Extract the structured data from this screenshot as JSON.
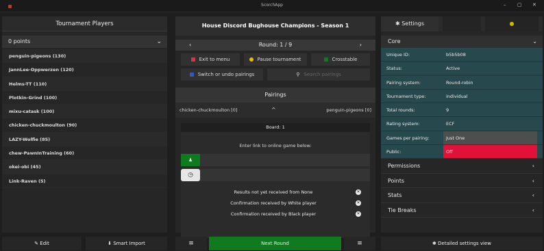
{
  "window": {
    "title": "ScorchApp",
    "controls": [
      "–",
      "▢",
      "✕"
    ]
  },
  "left": {
    "header": "Tournament Players",
    "select": "0 points",
    "players": [
      "penguin-pigeons (130)",
      "JannLee-Oppwerzen (120)",
      "Helms-TT (110)",
      "Plotkin-Grind (100)",
      "mixu-catask (100)",
      "chicken-chuckmoulton (90)",
      "LAZY-Wolfie (85)",
      "chew-PawnInTraining (60)",
      "okei-obi (45)",
      "Link-Raven (5)"
    ],
    "edit": "Edit",
    "smart_import": "Smart Import"
  },
  "middle": {
    "title": "House Discord Bughouse Champions - Season 1",
    "round_prev": "‹",
    "round": "Round: 1 / 9",
    "round_next": "›",
    "exit": "Exit to menu",
    "pause": "Pause tournament",
    "crosstable": "Crosstable",
    "switch": "Switch or undo pairings",
    "search_placeholder": "Search pairings",
    "pairings_header": "Pairings",
    "pair": {
      "white": "chicken-chuckmoulton [0]",
      "toggle": "^",
      "black": "penguin-pigeons [0]"
    },
    "board": "Board: 1",
    "link_hint": "Enter link to online game below:",
    "results_note": "Results not yet received from None",
    "conf_white": "Confirmation received by White player",
    "conf_black": "Confirmation received by Black player",
    "menu_left": "≡",
    "next_round": "Next Round",
    "menu_right": "≡"
  },
  "right": {
    "settings_tab": "Settings",
    "core": "Core",
    "fields": [
      {
        "k": "Unique ID:",
        "v": "b5b5b08"
      },
      {
        "k": "Status:",
        "v": "Active"
      },
      {
        "k": "Pairing system:",
        "v": "Round-robin"
      },
      {
        "k": "Tournament type:",
        "v": "individual"
      },
      {
        "k": "Total rounds:",
        "v": "9"
      },
      {
        "k": "Rating system:",
        "v": "ECF"
      },
      {
        "k": "Games per pairing:",
        "v": "Just One"
      },
      {
        "k": "Public:",
        "v": "Off"
      }
    ],
    "sections": [
      "Permissions",
      "Points",
      "Stats",
      "Tie Breaks"
    ],
    "detailed": "Detailed settings view"
  },
  "colors": {
    "green": "#0f7a1e",
    "teal": "#27484c",
    "red": "#e0123a",
    "orange": "#e69a1a"
  }
}
